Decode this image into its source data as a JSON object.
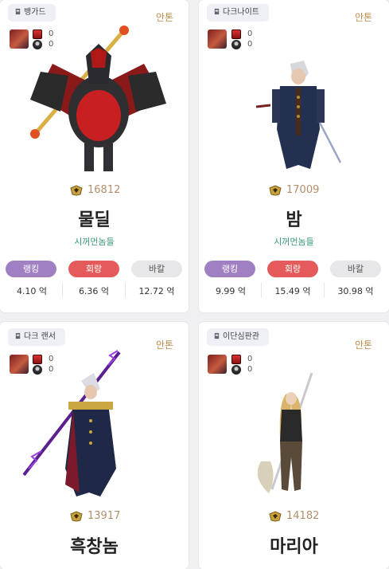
{
  "cards": [
    {
      "job": "뱅가드",
      "server": "안톤",
      "mini_top": "0",
      "mini_bottom": "0",
      "fame": "16812",
      "name": "물딜",
      "guild": "시꺼먼놈들",
      "labels": {
        "rank": "랭킹",
        "evade": "회랑",
        "bakal": "바칼"
      },
      "stats": {
        "rank": "4.10 억",
        "evade": "6.36 억",
        "bakal": "12.72 억"
      }
    },
    {
      "job": "다크나이트",
      "server": "안톤",
      "mini_top": "0",
      "mini_bottom": "0",
      "fame": "17009",
      "name": "밤",
      "guild": "시꺼먼놈들",
      "labels": {
        "rank": "랭킹",
        "evade": "회랑",
        "bakal": "바칼"
      },
      "stats": {
        "rank": "9.99 억",
        "evade": "15.49 억",
        "bakal": "30.98 억"
      }
    },
    {
      "job": "다크 랜서",
      "server": "안톤",
      "mini_top": "0",
      "mini_bottom": "0",
      "fame": "13917",
      "name": "흑창놈"
    },
    {
      "job": "이단심판관",
      "server": "안톤",
      "mini_top": "0",
      "mini_bottom": "0",
      "fame": "14182",
      "name": "마리아"
    }
  ],
  "icons": {
    "job": "tower-icon",
    "fame": "fame-crest-icon"
  },
  "colors": {
    "rank": "#a07fc3",
    "evade": "#e55b5b",
    "bakal": "#e7e7e9",
    "guild": "#3a9a7a",
    "server": "#c08a4c",
    "fame": "#b38f6a"
  }
}
